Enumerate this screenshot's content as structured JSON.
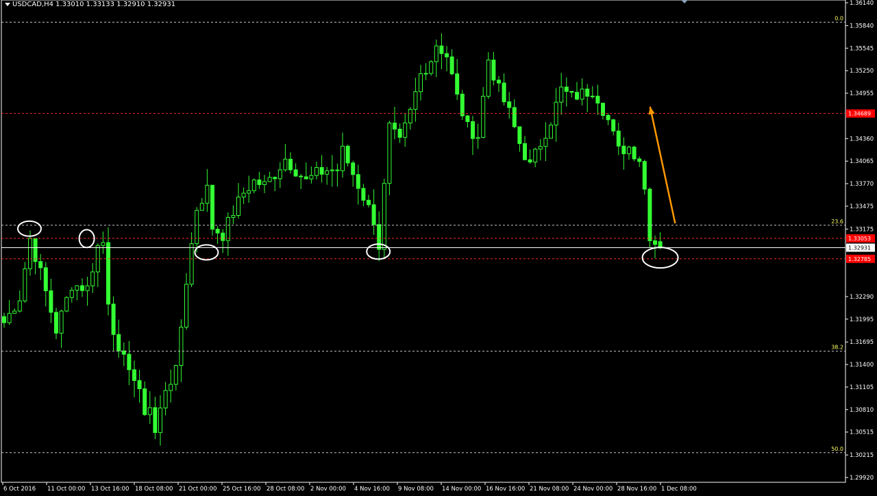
{
  "header": {
    "symbol_line": "USDCAD,H4  1.33010 1.33133 1.32910 1.32931"
  },
  "colors": {
    "background": "#000000",
    "candle": "#33ff33",
    "fib_line": "#c8c8c8",
    "fib_label": "#ffff66",
    "red_line": "#ff2a2a",
    "price_box_red": "#ff0000",
    "arrow": "#ff9900",
    "circle": "#ffffff",
    "axis_text": "#ffffff"
  },
  "icons": {
    "collapse": "triangle-down-icon",
    "marker": "diamond-marker-icon"
  },
  "chart_data": {
    "type": "candlestick",
    "title": "USDCAD,H4",
    "ohlc_current": {
      "open": 1.3301,
      "high": 1.33133,
      "low": 1.3291,
      "close": 1.32931
    },
    "ylim": [
      1.2985,
      1.3625
    ],
    "y_ticks": [
      "1.36140",
      "1.35840",
      "1.35545",
      "1.35250",
      "1.34955",
      "1.34360",
      "1.34065",
      "1.33770",
      "1.33475",
      "1.33175",
      "1.32290",
      "1.31995",
      "1.31695",
      "1.31400",
      "1.31105",
      "1.30810",
      "1.30515",
      "1.30215",
      "1.29920"
    ],
    "x_ticks": [
      "6 Oct 2016",
      "11 Oct 00:00",
      "13 Oct 16:00",
      "18 Oct 08:00",
      "21 Oct 00:00",
      "25 Oct 16:00",
      "28 Oct 08:00",
      "2 Nov 00:00",
      "4 Nov 16:00",
      "9 Nov 08:00",
      "14 Nov 00:00",
      "16 Nov 16:00",
      "21 Nov 08:00",
      "24 Nov 00:00",
      "28 Nov 16:00",
      "1 Dec 08:00"
    ],
    "fibonacci": [
      {
        "label": "0.0",
        "price": 1.35885
      },
      {
        "label": "23.6",
        "price": 1.33225
      },
      {
        "label": "38.2",
        "price": 1.31575
      },
      {
        "label": "50.0",
        "price": 1.30245
      }
    ],
    "horizontal_lines": [
      {
        "price": 1.34689,
        "label": "1.34689",
        "color": "red",
        "style": "dashed"
      },
      {
        "price": 1.33053,
        "label": "1.33053",
        "color": "red",
        "style": "dashed"
      },
      {
        "price": 1.32931,
        "label": "1.32931",
        "color": "white",
        "style": "solid"
      },
      {
        "price": 1.32785,
        "label": "1.32785",
        "color": "red",
        "style": "dashed"
      }
    ],
    "price_path": [
      [
        0,
        1.3195
      ],
      [
        3,
        1.3228
      ],
      [
        5,
        1.3305
      ],
      [
        7,
        1.326
      ],
      [
        10,
        1.3185
      ],
      [
        13,
        1.3245
      ],
      [
        16,
        1.324
      ],
      [
        18,
        1.3295
      ],
      [
        19,
        1.33
      ],
      [
        20,
        1.3225
      ],
      [
        22,
        1.315
      ],
      [
        24,
        1.314
      ],
      [
        27,
        1.308
      ],
      [
        28,
        1.3085
      ],
      [
        29,
        1.305
      ],
      [
        31,
        1.311
      ],
      [
        33,
        1.313
      ],
      [
        35,
        1.325
      ],
      [
        37,
        1.3345
      ],
      [
        39,
        1.337
      ],
      [
        40,
        1.332
      ],
      [
        42,
        1.331
      ],
      [
        44,
        1.334
      ],
      [
        46,
        1.3365
      ],
      [
        48,
        1.338
      ],
      [
        50,
        1.3375
      ],
      [
        52,
        1.339
      ],
      [
        54,
        1.341
      ],
      [
        56,
        1.3395
      ],
      [
        58,
        1.338
      ],
      [
        60,
        1.339
      ],
      [
        62,
        1.3395
      ],
      [
        64,
        1.3395
      ],
      [
        65,
        1.342
      ],
      [
        67,
        1.339
      ],
      [
        69,
        1.336
      ],
      [
        71,
        1.333
      ],
      [
        72,
        1.3295
      ],
      [
        74,
        1.345
      ],
      [
        76,
        1.343
      ],
      [
        78,
        1.347
      ],
      [
        80,
        1.352
      ],
      [
        82,
        1.354
      ],
      [
        83,
        1.356
      ],
      [
        85,
        1.3545
      ],
      [
        87,
        1.349
      ],
      [
        89,
        1.345
      ],
      [
        91,
        1.344
      ],
      [
        93,
        1.354
      ],
      [
        95,
        1.35
      ],
      [
        97,
        1.347
      ],
      [
        99,
        1.343
      ],
      [
        101,
        1.34
      ],
      [
        103,
        1.343
      ],
      [
        105,
        1.346
      ],
      [
        107,
        1.35
      ],
      [
        109,
        1.349
      ],
      [
        111,
        1.3495
      ],
      [
        113,
        1.35
      ],
      [
        114,
        1.349
      ],
      [
        116,
        1.346
      ],
      [
        118,
        1.342
      ],
      [
        120,
        1.3425
      ],
      [
        122,
        1.341
      ],
      [
        123,
        1.337
      ],
      [
        124,
        1.331
      ],
      [
        125,
        1.33
      ],
      [
        126,
        1.3295
      ]
    ],
    "annotations": [
      {
        "type": "circle",
        "at_bar": 5,
        "price": 1.3318
      },
      {
        "type": "circle",
        "at_bar": 16,
        "price": 1.3305
      },
      {
        "type": "circle",
        "at_bar": 39,
        "price": 1.3287
      },
      {
        "type": "circle",
        "at_bar": 72,
        "price": 1.3288
      },
      {
        "type": "circle",
        "at_bar": 126,
        "price": 1.328
      },
      {
        "type": "arrow",
        "direction": "up",
        "from_bar": 129,
        "from_price": 1.3325,
        "to_bar": 123,
        "to_price": 1.3485
      }
    ]
  }
}
